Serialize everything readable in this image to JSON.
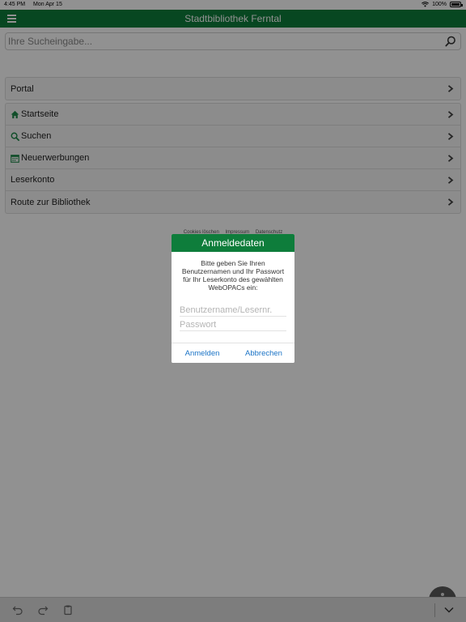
{
  "status_bar": {
    "time": "4:45 PM",
    "date": "Mon Apr 15",
    "battery": "100%"
  },
  "header": {
    "title": "Stadtbibliothek Ferntal"
  },
  "search": {
    "placeholder": "Ihre Sucheingabe..."
  },
  "portal_list": {
    "items": [
      {
        "label": "Portal"
      }
    ]
  },
  "nav_list": {
    "items": [
      {
        "label": "Startseite",
        "icon": "home-icon"
      },
      {
        "label": "Suchen",
        "icon": "search-icon"
      },
      {
        "label": "Neuerwerbungen",
        "icon": "calendar-icon"
      },
      {
        "label": "Leserkonto"
      },
      {
        "label": "Route zur Bibliothek"
      }
    ]
  },
  "footer": {
    "links": [
      "Cookies löschen",
      "Impressum",
      "Datenschutz"
    ]
  },
  "dialog": {
    "title": "Anmeldedaten",
    "message": "Bitte geben Sie Ihren Benutzernamen und Ihr Passwort für Ihr Leserkonto des gewählten WebOPACs ein:",
    "username_placeholder": "Benutzername/Lesernr.",
    "password_placeholder": "Passwort",
    "login_label": "Anmelden",
    "cancel_label": "Abbrechen"
  },
  "colors": {
    "accent": "#0e7d3b",
    "link": "#1a73c6",
    "icon_green": "#1e8a4a"
  }
}
